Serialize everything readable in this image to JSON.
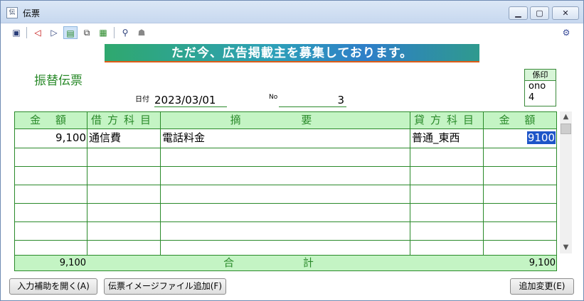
{
  "window": {
    "title": "伝票",
    "app_icon": "voucher-app-icon",
    "buttons": [
      "minimize-icon",
      "maximize-icon",
      "close-icon"
    ]
  },
  "toolbar": {
    "icons": [
      "new-entry-icon",
      "prev-icon",
      "next-icon",
      "list-icon",
      "copy-icon",
      "delete-icon",
      "search-icon",
      "user-icon",
      "settings-icon"
    ]
  },
  "banner": {
    "text": "ただ今、広告掲載主を募集しております。"
  },
  "voucher": {
    "title": "振替伝票",
    "stamp_label": "係印",
    "stamp_value_1": "ono",
    "stamp_value_2": "4",
    "date_label": "日付",
    "date": "2023/03/01",
    "no_label": "No",
    "no": "3"
  },
  "table": {
    "headers": {
      "debit_amount": "金 額",
      "debit_account": "借方科目",
      "description": "摘 要",
      "credit_account": "貸方科目",
      "credit_amount": "金 額"
    },
    "rows": [
      {
        "debit_amount": "9,100",
        "debit_account": "通信費",
        "description": "電話料金",
        "credit_account": "普通_東西",
        "credit_amount": "9100"
      }
    ],
    "total_label": "合 計",
    "total_debit": "9,100",
    "total_credit": "9,100"
  },
  "buttons": {
    "input_help": "入力補助を開く(A)",
    "add_image": "伝票イメージファイル追加(F)",
    "add_change": "追加変更(E)"
  },
  "colors": {
    "grid_line": "#2a8a2a",
    "header_bg": "#c4f4c4",
    "selection": "#1e55c8"
  }
}
